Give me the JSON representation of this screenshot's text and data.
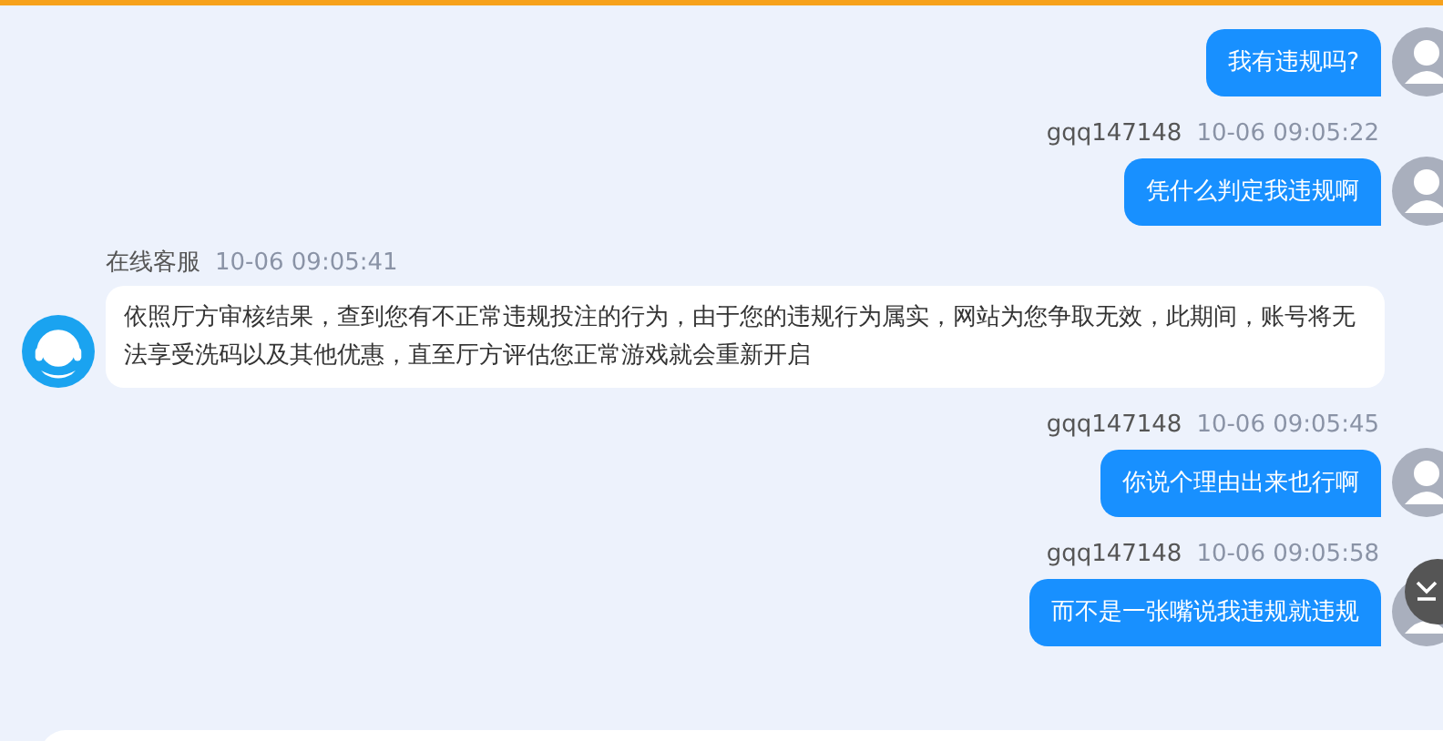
{
  "messages": [
    {
      "kind": "user",
      "text": "我有违规吗?"
    },
    {
      "kind": "user",
      "sender": "gqq147148",
      "time": "10-06 09:05:22",
      "text": "凭什么判定我违规啊"
    },
    {
      "kind": "agent",
      "sender": "在线客服",
      "time": "10-06 09:05:41",
      "text": "依照厅方审核结果，查到您有不正常违规投注的行为，由于您的违规行为属实，网站为您争取无效，此期间，账号将无法享受洗码以及其他优惠，直至厅方评估您正常游戏就会重新开启"
    },
    {
      "kind": "user",
      "sender": "gqq147148",
      "time": "10-06 09:05:45",
      "text": "你说个理由出来也行啊"
    },
    {
      "kind": "user",
      "sender": "gqq147148",
      "time": "10-06 09:05:58",
      "text": "而不是一张嘴说我违规就违规"
    }
  ]
}
